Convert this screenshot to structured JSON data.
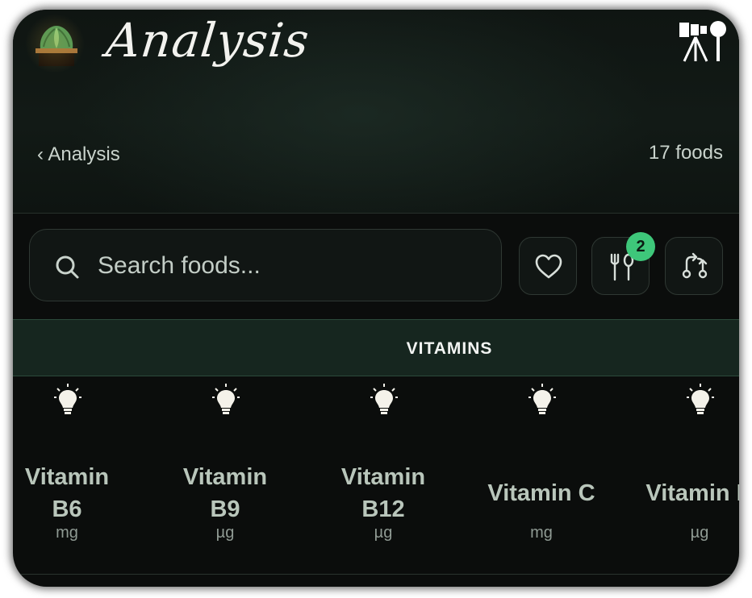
{
  "header": {
    "app_title": "Analysis",
    "logo_icon": "plant-pot-icon",
    "top_right_icon": "telescope-icon"
  },
  "nav": {
    "back_label": "‹ Analysis",
    "food_count": "17 foods"
  },
  "search": {
    "placeholder": "Search foods..."
  },
  "toolbar": {
    "favorites_icon": "heart-icon",
    "filter_icon": "fork-spoon-icon",
    "filter_badge": "2",
    "compare_icon": "swap-arrows-icon"
  },
  "tabs": {
    "active": "VITAMINS"
  },
  "nutrients": [
    {
      "name_line1": "Vitamin",
      "name_line2": "B6",
      "unit": "mg",
      "icon": "lightbulb-icon"
    },
    {
      "name_line1": "Vitamin",
      "name_line2": "B9",
      "unit": "µg",
      "icon": "lightbulb-icon"
    },
    {
      "name_line1": "Vitamin",
      "name_line2": "B12",
      "unit": "µg",
      "icon": "lightbulb-icon"
    },
    {
      "name_line1": "Vitamin C",
      "name_line2": "",
      "unit": "mg",
      "icon": "lightbulb-icon"
    },
    {
      "name_line1": "Vitamin D",
      "name_line2": "",
      "unit": "µg",
      "icon": "lightbulb-icon"
    }
  ],
  "colors": {
    "background": "#0b0d0c",
    "accent_green": "#3ec77a",
    "tab_bar": "#16261f",
    "nutrient_text": "#b9c6bb"
  }
}
